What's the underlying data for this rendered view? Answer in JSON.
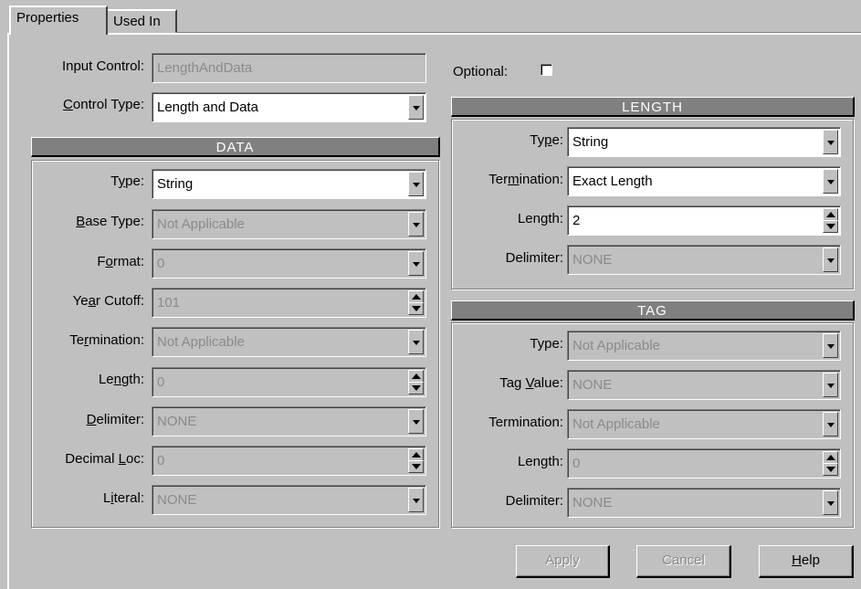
{
  "tabs": [
    {
      "label": "Properties"
    },
    {
      "label": "Used In"
    }
  ],
  "general": {
    "input_control_label": "Input Control:",
    "input_control_value": "LengthAndData",
    "control_type_label_pre": "",
    "control_type_label_u": "C",
    "control_type_label_post": "ontrol Type:",
    "control_type_value": "Length and Data",
    "optional_label": "Optional:"
  },
  "data_section": {
    "header": "DATA",
    "type": {
      "pre": "T",
      "u": "y",
      "post": "pe:",
      "value": "String"
    },
    "base_type": {
      "pre": "",
      "u": "B",
      "post": "ase Type:",
      "value": "Not Applicable"
    },
    "format": {
      "pre": "F",
      "u": "o",
      "post": "rmat:",
      "value": "0"
    },
    "year_cutoff": {
      "pre": "Ye",
      "u": "a",
      "post": "r Cutoff:",
      "value": "101"
    },
    "termination": {
      "pre": "Te",
      "u": "r",
      "post": "mination:",
      "value": "Not Applicable"
    },
    "length": {
      "pre": "Le",
      "u": "n",
      "post": "gth:",
      "value": "0"
    },
    "delimiter": {
      "pre": "",
      "u": "D",
      "post": "elimiter:",
      "value": "NONE"
    },
    "decimal_loc": {
      "pre": "Decimal ",
      "u": "L",
      "post": "oc:",
      "value": "0"
    },
    "literal": {
      "pre": "L",
      "u": "i",
      "post": "teral:",
      "value": "NONE"
    }
  },
  "length_section": {
    "header": "LENGTH",
    "type": {
      "pre": "Ty",
      "u": "p",
      "post": "e:",
      "value": "String"
    },
    "termination": {
      "pre": "Ter",
      "u": "m",
      "post": "ination:",
      "value": "Exact Length"
    },
    "length": {
      "label": "Length:",
      "value": "2"
    },
    "delimiter": {
      "label": "Delimiter:",
      "value": "NONE"
    }
  },
  "tag_section": {
    "header": "TAG",
    "type": {
      "label": "Type:",
      "value": "Not Applicable"
    },
    "tag_value": {
      "pre": "Tag ",
      "u": "V",
      "post": "alue:",
      "value": "NONE"
    },
    "termination": {
      "label": "Termination:",
      "value": "Not Applicable"
    },
    "length": {
      "label": "Length:",
      "value": "0"
    },
    "delimiter": {
      "label": "Delimiter:",
      "value": "NONE"
    }
  },
  "buttons": {
    "apply": "Apply",
    "cancel": "Cancel",
    "help_u": "H",
    "help_post": "elp"
  },
  "colors": {
    "face": "#c0c0c0",
    "header": "#808080",
    "disabled_text": "#8a8a8a"
  }
}
